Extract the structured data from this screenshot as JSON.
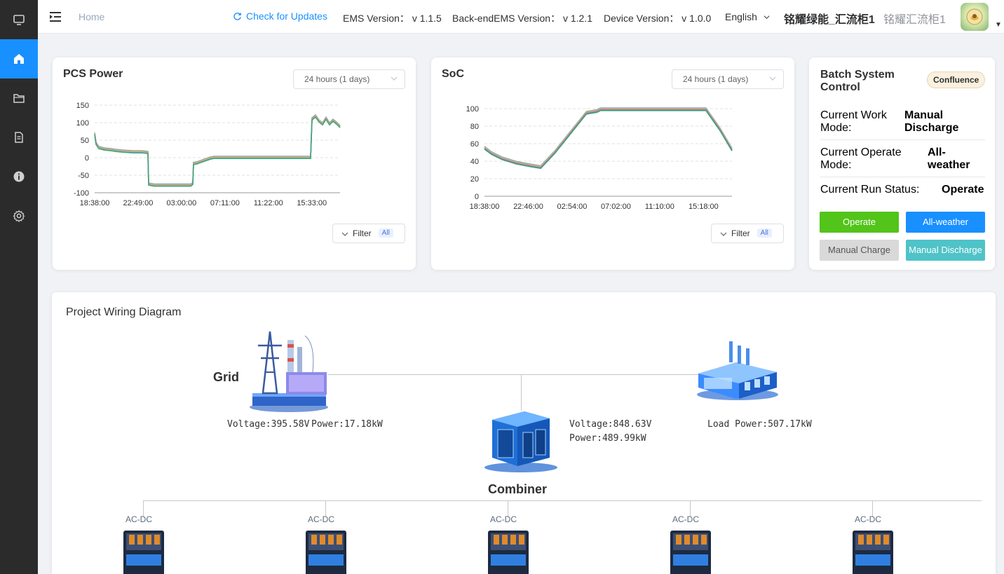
{
  "sidebar": {
    "items": [
      {
        "icon": "monitor-icon"
      },
      {
        "icon": "home-icon",
        "active": true
      },
      {
        "icon": "folder-icon"
      },
      {
        "icon": "document-icon"
      },
      {
        "icon": "info-icon"
      },
      {
        "icon": "settings-icon"
      }
    ]
  },
  "header": {
    "breadcrumb": "Home",
    "check_updates": "Check for Updates",
    "ems_version": "EMS Version： v 1.1.5",
    "backend_version": "Back-endEMS Version： v 1.2.1",
    "device_version": "Device Version：  v 1.0.0",
    "language": "English",
    "station": "铭耀绿能_汇流柜1",
    "station_sub": "铭耀汇流柜1"
  },
  "pcs_card": {
    "title": "PCS Power",
    "range": "24 hours (1 days)",
    "filter": "Filter",
    "filter_badge": "All"
  },
  "soc_card": {
    "title": "SoC",
    "range": "24 hours (1 days)",
    "filter": "Filter",
    "filter_badge": "All"
  },
  "batch": {
    "title": "Batch System Control",
    "tag": "Confluence",
    "work_mode_label": "Current Work Mode:",
    "work_mode_value": "Manual Discharge",
    "operate_mode_label": "Current Operate Mode:",
    "operate_mode_value": "All-weather",
    "run_status_label": "Current Run Status:",
    "run_status_value": "Operate",
    "btn_operate": "Operate",
    "btn_allweather": "All-weather",
    "btn_manual_charge": "Manual Charge",
    "btn_manual_discharge": "Manual Discharge",
    "colors": {
      "operate": "#52c41a",
      "allweather": "#1890ff",
      "charge": "#d9d9d9",
      "discharge": "#4fc3c8"
    }
  },
  "wiring": {
    "title": "Project Wiring Diagram",
    "grid_label": "Grid",
    "grid_voltage": "Voltage:395.58V",
    "grid_power": "Power:17.18kW",
    "combiner_label": "Combiner",
    "combiner_voltage": "Voltage:848.63V",
    "combiner_power": "Power:489.99kW",
    "load_power": "Load Power:507.17kW",
    "acdc_labels": [
      "AC-DC",
      "AC-DC",
      "AC-DC",
      "AC-DC",
      "AC-DC"
    ]
  },
  "chart_data": [
    {
      "type": "line",
      "title": "PCS Power",
      "x_ticks": [
        "18:38:00",
        "22:49:00",
        "03:00:00",
        "07:11:00",
        "11:22:00",
        "15:33:00"
      ],
      "y_ticks": [
        150,
        100,
        50,
        0,
        -50,
        -100
      ],
      "ylim": [
        -100,
        150
      ],
      "grid": true,
      "series_colors": [
        "#5470c6",
        "#91cc75",
        "#fac858",
        "#ee6666",
        "#73c0de",
        "#3ba272"
      ],
      "points": [
        [
          0,
          68
        ],
        [
          2,
          40
        ],
        [
          6,
          28
        ],
        [
          14,
          24
        ],
        [
          24,
          22
        ],
        [
          30,
          20
        ],
        [
          40,
          18
        ],
        [
          55,
          16
        ],
        [
          68,
          16
        ],
        [
          76,
          14
        ],
        [
          77,
          -76
        ],
        [
          85,
          -79
        ],
        [
          100,
          -79
        ],
        [
          120,
          -79
        ],
        [
          137,
          -79
        ],
        [
          140,
          -74
        ],
        [
          141,
          -17
        ],
        [
          145,
          -16
        ],
        [
          165,
          -2
        ],
        [
          170,
          0
        ],
        [
          190,
          0
        ],
        [
          250,
          0
        ],
        [
          300,
          0
        ],
        [
          308,
          0
        ],
        [
          310,
          110
        ],
        [
          315,
          118
        ],
        [
          320,
          104
        ],
        [
          325,
          96
        ],
        [
          330,
          112
        ],
        [
          335,
          96
        ],
        [
          340,
          106
        ],
        [
          345,
          98
        ],
        [
          350,
          88
        ]
      ]
    },
    {
      "type": "line",
      "title": "SoC",
      "x_ticks": [
        "18:38:00",
        "22:46:00",
        "02:54:00",
        "07:02:00",
        "11:10:00",
        "15:18:00"
      ],
      "y_ticks": [
        100,
        80,
        60,
        40,
        20,
        0
      ],
      "ylim": [
        0,
        100
      ],
      "grid": true,
      "series_colors": [
        "#5470c6",
        "#91cc75",
        "#fac858",
        "#ee6666",
        "#73c0de",
        "#9a60b4",
        "#3ba272"
      ],
      "points": [
        [
          0,
          55
        ],
        [
          10,
          49
        ],
        [
          25,
          43
        ],
        [
          45,
          38
        ],
        [
          65,
          35
        ],
        [
          80,
          33
        ],
        [
          100,
          50
        ],
        [
          125,
          75
        ],
        [
          145,
          95
        ],
        [
          160,
          97
        ],
        [
          165,
          99
        ],
        [
          200,
          99
        ],
        [
          260,
          99
        ],
        [
          315,
          99
        ],
        [
          335,
          76
        ],
        [
          352,
          53
        ]
      ]
    }
  ]
}
